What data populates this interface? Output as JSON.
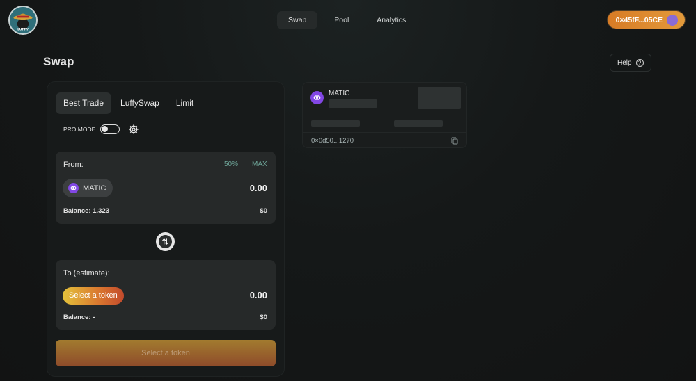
{
  "header": {
    "logo_text": "LUFFY",
    "nav": [
      "Swap",
      "Pool",
      "Analytics"
    ],
    "wallet": "0×45fF...05CE"
  },
  "page": {
    "title": "Swap",
    "help": "Help"
  },
  "swap": {
    "tabs": [
      "Best Trade",
      "LuffySwap",
      "Limit"
    ],
    "pro_mode": "PRO MODE",
    "from": {
      "label": "From:",
      "pct50": "50%",
      "max": "MAX",
      "token": "MATIC",
      "amount": "0.00",
      "balance": "Balance: 1.323",
      "usd": "$0"
    },
    "to": {
      "label": "To (estimate):",
      "select": "Select a token",
      "amount": "0.00",
      "balance": "Balance: -",
      "usd": "$0"
    },
    "cta": "Select a token"
  },
  "token_info": {
    "name": "MATIC",
    "address": "0×0d50...1270"
  },
  "colors": {
    "accent_orange": "#e39a3b",
    "matic_purple": "#8247e5",
    "percent_green": "#6fa79a"
  }
}
